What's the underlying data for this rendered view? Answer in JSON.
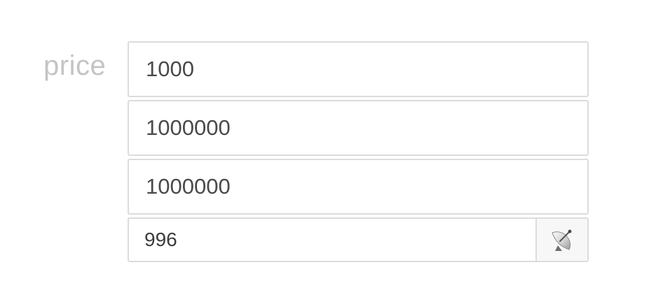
{
  "form": {
    "label": "price",
    "fields": [
      {
        "value": "1000"
      },
      {
        "value": "1000000"
      },
      {
        "value": "1000000"
      }
    ],
    "addon_field": {
      "value": "996",
      "button_icon": "satellite-dish-icon"
    }
  }
}
